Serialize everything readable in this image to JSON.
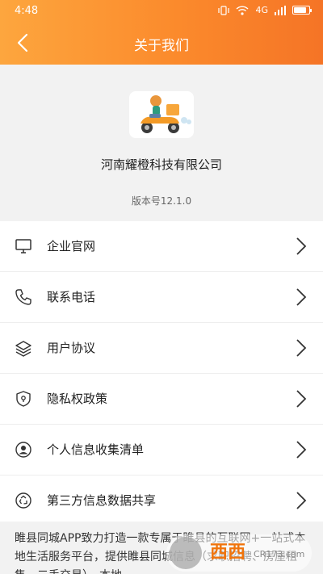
{
  "status_bar": {
    "time": "4:48",
    "network": "4G",
    "battery_level": 0.85
  },
  "header": {
    "back_icon": "chevron-left-icon",
    "title": "关于我们"
  },
  "app": {
    "logo_icon": "delivery-scooter-logo",
    "company": "河南耀橙科技有限公司",
    "version": "版本号12.1.0"
  },
  "menu": [
    {
      "icon": "monitor-icon",
      "label": "企业官网"
    },
    {
      "icon": "phone-icon",
      "label": "联系电话"
    },
    {
      "icon": "layers-icon",
      "label": "用户协议"
    },
    {
      "icon": "shield-lock-icon",
      "label": "隐私权政策"
    },
    {
      "icon": "user-circle-icon",
      "label": "个人信息收集清单"
    },
    {
      "icon": "recycle-icon",
      "label": "第三方信息数据共享"
    }
  ],
  "description": "睢县同城APP致力打造一款专属于睢县的互联网+一站式本地生活服务平台，提供睢县同城信息（求职招聘、房屋租售、二手交易）、本地",
  "watermark": {
    "brand": "西西",
    "sub": "CR173.com"
  },
  "colors": {
    "header_start": "#fda63e",
    "header_end": "#f57426",
    "accent": "#f0740c"
  }
}
